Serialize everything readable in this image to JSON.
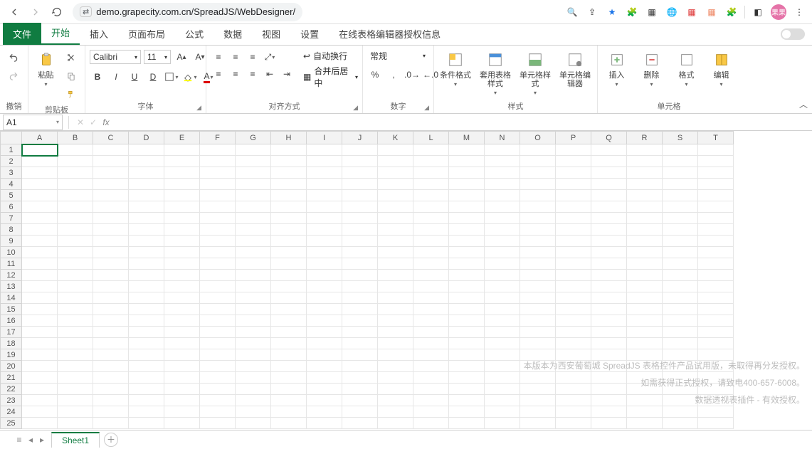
{
  "browser": {
    "url": "demo.grapecity.com.cn/SpreadJS/WebDesigner/",
    "avatar_text": "果果"
  },
  "tabs": {
    "file": "文件",
    "items": [
      "开始",
      "插入",
      "页面布局",
      "公式",
      "数据",
      "视图",
      "设置",
      "在线表格编辑器授权信息"
    ],
    "active_index": 0
  },
  "ribbon": {
    "undo_group": "撤销",
    "clipboard": {
      "paste": "粘贴",
      "group": "剪贴板"
    },
    "font": {
      "name": "Calibri",
      "size": "11",
      "bold": "B",
      "italic": "I",
      "underline": "U",
      "dunderline": "D",
      "group": "字体"
    },
    "align": {
      "wrap": "自动换行",
      "merge": "合并后居中",
      "group": "对齐方式"
    },
    "number": {
      "format": "常规",
      "group": "数字",
      "percent": "%",
      "comma": ",",
      "inc_dec": "⁰₀",
      "dec_dec": "⁰₀"
    },
    "styles": {
      "cond": "条件格式",
      "table": "套用表格样式",
      "cell": "单元格样式",
      "editor": "单元格编辑器",
      "group": "样式"
    },
    "cells": {
      "insert": "插入",
      "delete": "删除",
      "format": "格式",
      "edit": "编辑",
      "group": "单元格"
    }
  },
  "fx": {
    "name_box": "A1",
    "fx": "fx"
  },
  "grid": {
    "cols": [
      "A",
      "B",
      "C",
      "D",
      "E",
      "F",
      "G",
      "H",
      "I",
      "J",
      "K",
      "L",
      "M",
      "N",
      "O",
      "P",
      "Q",
      "R",
      "S",
      "T"
    ],
    "rows": 25,
    "selected": "A1"
  },
  "watermark": {
    "l1": "本版本为西安葡萄城 SpreadJS 表格控件产品试用版，未取得再分发授权。",
    "l2": "如需获得正式授权，请致电400-657-6008。",
    "l3": "数据透视表插件 - 有效授权。"
  },
  "sheets": {
    "active": "Sheet1"
  }
}
